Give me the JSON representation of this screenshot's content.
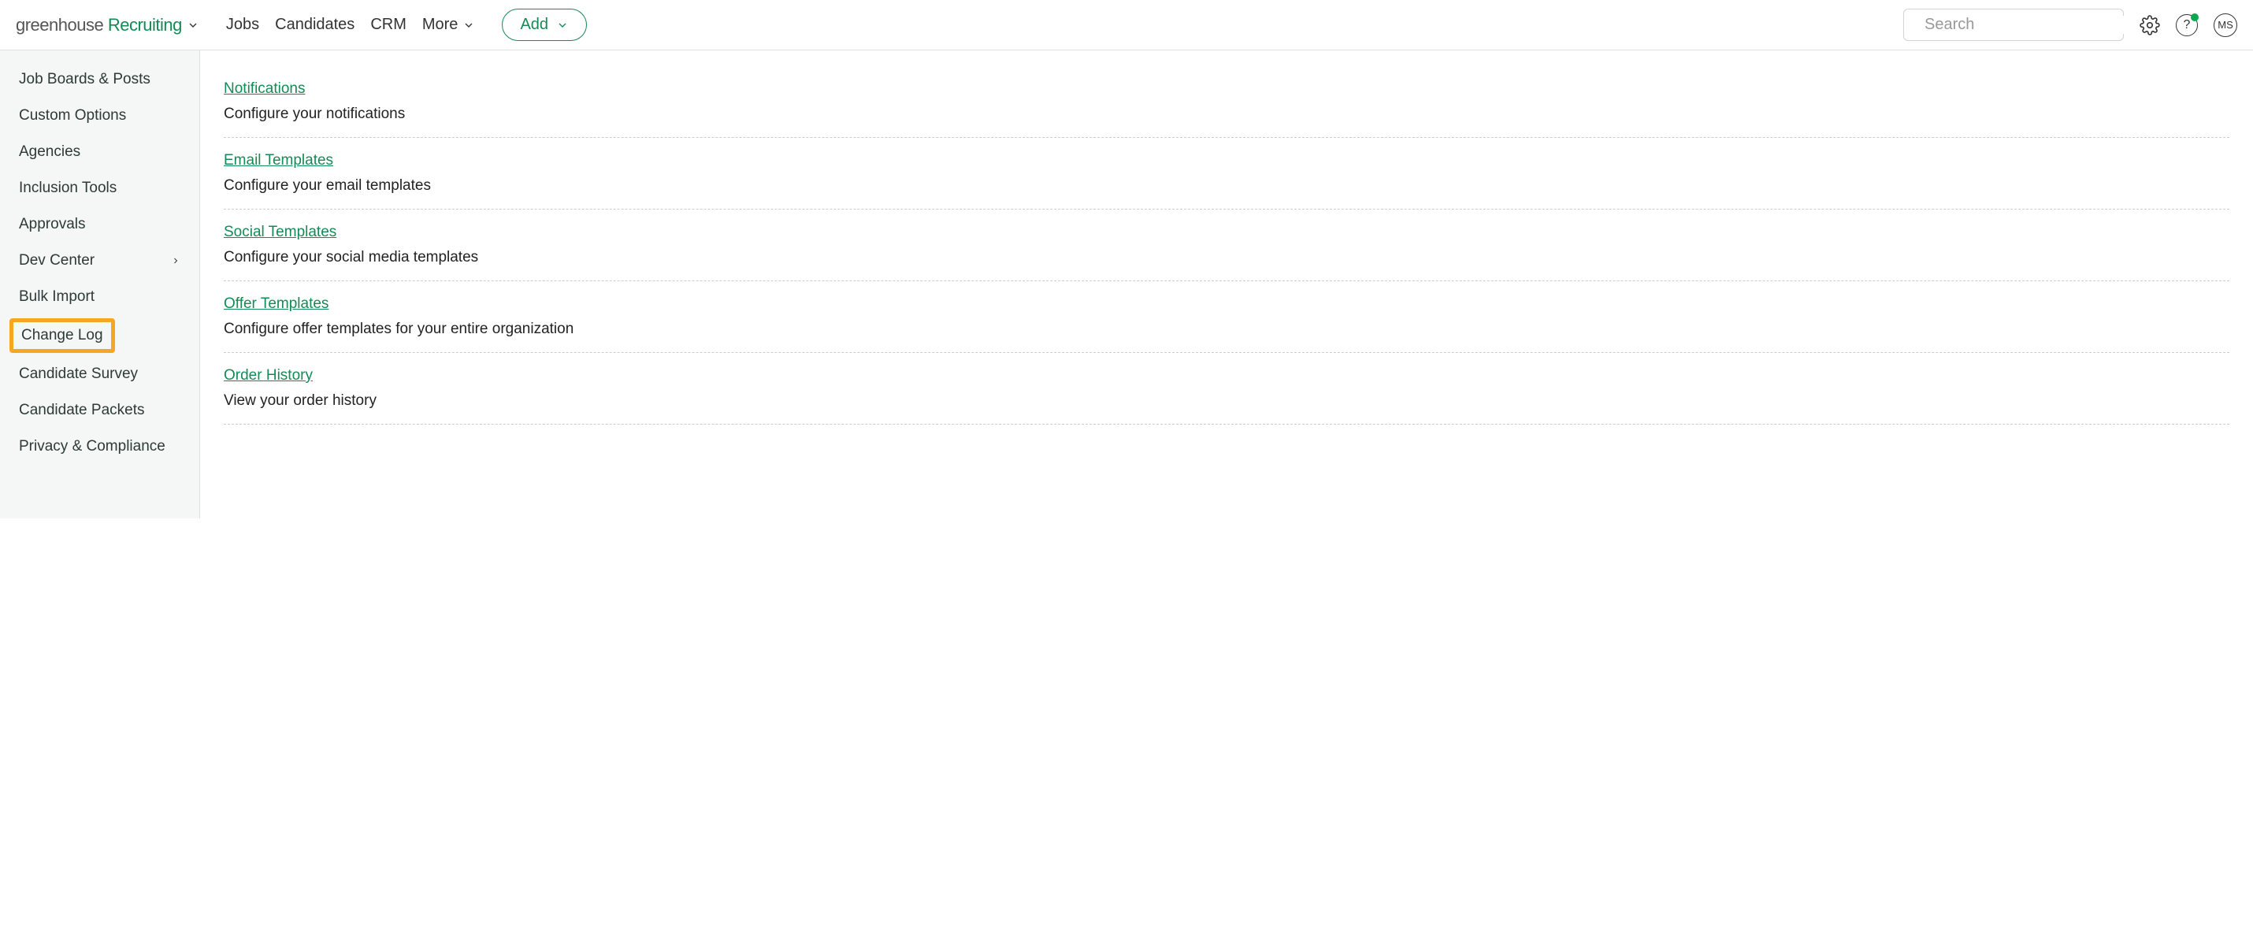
{
  "header": {
    "logo_part1": "greenhouse",
    "logo_part2": " Recruiting",
    "nav": [
      {
        "label": "Jobs"
      },
      {
        "label": "Candidates"
      },
      {
        "label": "CRM"
      },
      {
        "label": "More",
        "has_chevron": true
      }
    ],
    "add_label": "Add",
    "search_placeholder": "Search",
    "avatar_initials": "MS"
  },
  "sidebar": {
    "items": [
      {
        "label": "Job Boards & Posts"
      },
      {
        "label": "Custom Options"
      },
      {
        "label": "Agencies"
      },
      {
        "label": "Inclusion Tools"
      },
      {
        "label": "Approvals"
      },
      {
        "label": "Dev Center",
        "has_chevron": true
      },
      {
        "label": "Bulk Import"
      },
      {
        "label": "Change Log",
        "highlighted": true
      },
      {
        "label": "Candidate Survey"
      },
      {
        "label": "Candidate Packets"
      },
      {
        "label": "Privacy & Compliance"
      }
    ]
  },
  "main": {
    "settings": [
      {
        "title": "Notifications",
        "desc": "Configure your notifications"
      },
      {
        "title": "Email Templates",
        "desc": "Configure your email templates"
      },
      {
        "title": "Social Templates",
        "desc": "Configure your social media templates"
      },
      {
        "title": "Offer Templates",
        "desc": "Configure offer templates for your entire organization"
      },
      {
        "title": "Order History",
        "desc": "View your order history"
      }
    ]
  }
}
